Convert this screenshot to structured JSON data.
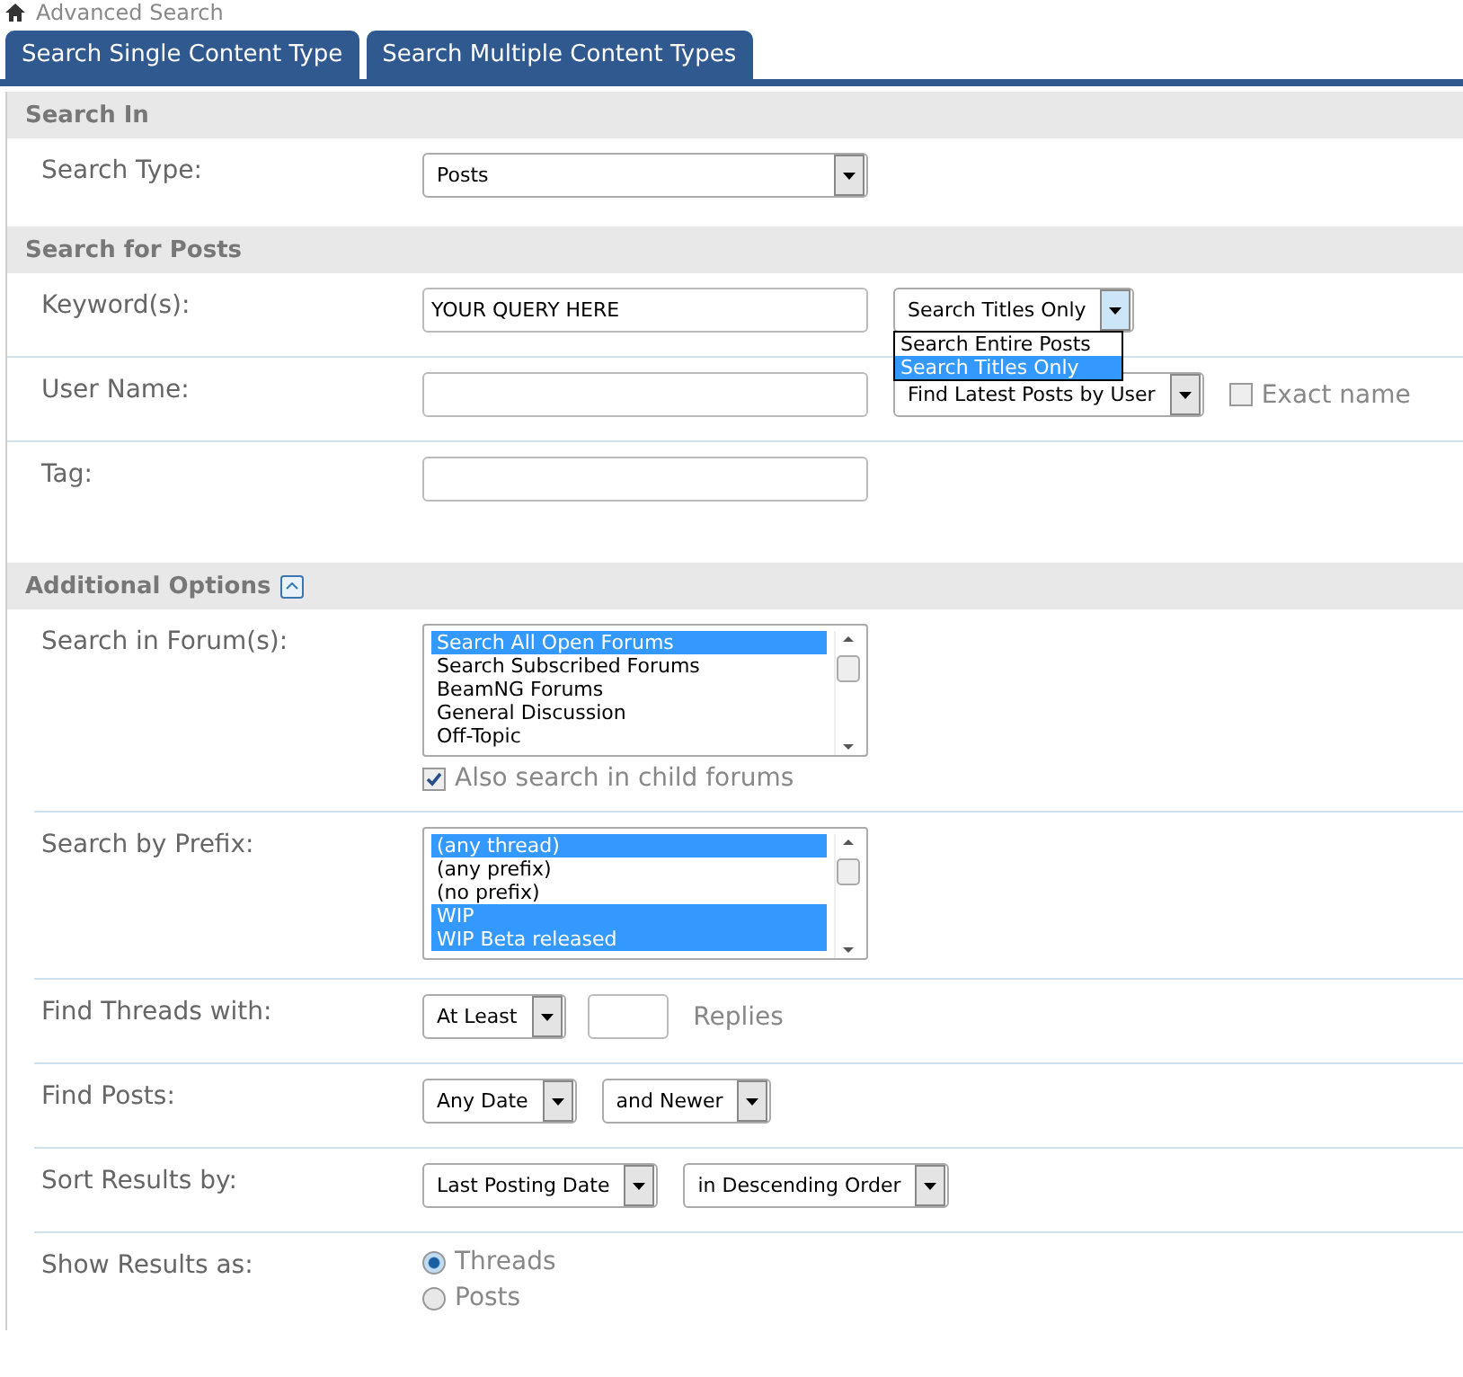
{
  "breadcrumb": {
    "text": "Advanced Search"
  },
  "tabs": [
    {
      "label": "Search Single Content Type",
      "selected": false
    },
    {
      "label": "Search Multiple Content Types",
      "selected": false
    }
  ],
  "sections": [
    {
      "title": "Search In",
      "collapsible": false,
      "rows": [
        {
          "label": "Search Type:",
          "lines": [
            [
              {
                "kind": "select",
                "value": "Posts",
                "open": false
              }
            ]
          ]
        }
      ]
    },
    {
      "title": "Search for Posts",
      "collapsible": false,
      "rows": [
        {
          "label": "Keyword(s):",
          "lines": [
            [
              {
                "kind": "text",
                "value": "YOUR QUERY HERE"
              },
              {
                "kind": "select",
                "value": "Search Titles Only",
                "open": true,
                "options": [
                  {
                    "label": "Search Entire Posts",
                    "selected": false
                  },
                  {
                    "label": "Search Titles Only",
                    "selected": true
                  }
                ]
              }
            ]
          ]
        },
        {
          "label": "User Name:",
          "lines": [
            [
              {
                "kind": "text"
              },
              {
                "kind": "select",
                "value": "Find Latest Posts by User",
                "open": false
              },
              {
                "kind": "checkbox",
                "label": "Exact name",
                "checked": false
              }
            ]
          ]
        },
        {
          "label": "Tag:",
          "lines": [
            [
              {
                "kind": "text"
              }
            ]
          ]
        }
      ]
    },
    {
      "title": "Additional Options",
      "collapsible": true,
      "rows": [
        {
          "label": "Search in Forum(s):",
          "lines": [
            [
              {
                "kind": "listbox",
                "options": [
                  {
                    "label": "Search All Open Forums",
                    "selected": true
                  },
                  {
                    "label": "Search Subscribed Forums",
                    "selected": false
                  },
                  {
                    "label": "BeamNG Forums",
                    "selected": false
                  },
                  {
                    "label": "General Discussion",
                    "selected": false
                  },
                  {
                    "label": "Off-Topic",
                    "selected": false
                  }
                ]
              }
            ],
            [
              {
                "kind": "checkbox",
                "label": "Also search in child forums",
                "checked": true
              }
            ]
          ]
        },
        {
          "label": "Search by Prefix:",
          "lines": [
            [
              {
                "kind": "listbox",
                "options": [
                  {
                    "label": "(any thread)",
                    "selected": true
                  },
                  {
                    "label": "(any prefix)",
                    "selected": false
                  },
                  {
                    "label": "(no prefix)",
                    "selected": false
                  },
                  {
                    "label": "WIP",
                    "selected": true
                  },
                  {
                    "label": "WIP Beta released",
                    "selected": true
                  }
                ]
              }
            ]
          ]
        },
        {
          "label": "Find Threads with:",
          "lines": [
            [
              {
                "kind": "select",
                "value": "At Least",
                "open": false
              },
              {
                "kind": "short-text"
              },
              {
                "kind": "label",
                "text": "Replies"
              }
            ]
          ]
        },
        {
          "label": "Find Posts:",
          "lines": [
            [
              {
                "kind": "select",
                "value": "Any Date",
                "open": false
              },
              {
                "kind": "select",
                "value": "and Newer",
                "open": false
              }
            ]
          ]
        },
        {
          "label": "Sort Results by:",
          "lines": [
            [
              {
                "kind": "select",
                "value": "Last Posting Date",
                "open": false
              },
              {
                "kind": "select",
                "value": "in Descending Order",
                "open": false
              }
            ]
          ]
        },
        {
          "label": "Show Results as:",
          "lines": [
            [
              {
                "kind": "radio",
                "label": "Threads",
                "selected": true
              }
            ],
            [
              {
                "kind": "radio",
                "label": "Posts",
                "selected": false
              }
            ]
          ]
        }
      ]
    }
  ]
}
